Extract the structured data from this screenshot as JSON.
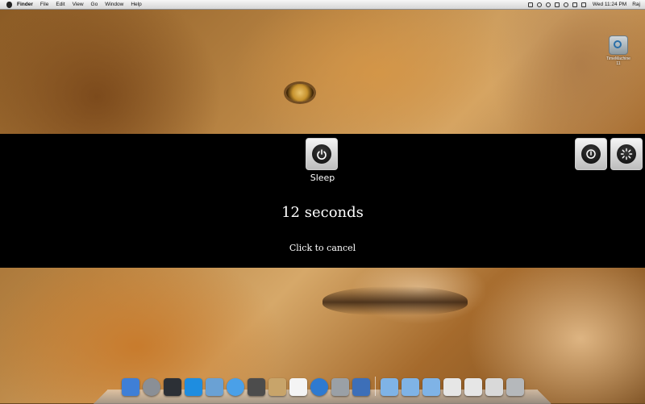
{
  "menubar": {
    "app_name": "Finder",
    "items": [
      "File",
      "Edit",
      "View",
      "Go",
      "Window",
      "Help"
    ],
    "clock": "Wed 11:24 PM",
    "user": "Raj"
  },
  "desktop": {
    "icon_label": "TimeMachine11"
  },
  "overlay": {
    "sleep_label": "Sleep",
    "countdown": "12 seconds",
    "cancel": "Click to cancel"
  },
  "dock": {
    "apps": [
      {
        "name": "finder-icon",
        "color": "#3f7fd6"
      },
      {
        "name": "launchpad-icon",
        "color": "#8a8f96"
      },
      {
        "name": "mission-control-icon",
        "color": "#2c3036"
      },
      {
        "name": "app-store-icon",
        "color": "#1e8de0"
      },
      {
        "name": "preview-icon",
        "color": "#6aa1d4"
      },
      {
        "name": "safari-icon",
        "color": "#4aa0e8"
      },
      {
        "name": "facetime-icon",
        "color": "#4c4c4c"
      },
      {
        "name": "address-book-icon",
        "color": "#c8a46a"
      },
      {
        "name": "ical-icon",
        "color": "#f4f4f4"
      },
      {
        "name": "itunes-icon",
        "color": "#2e7ad0"
      },
      {
        "name": "system-preferences-icon",
        "color": "#9aa0a6"
      },
      {
        "name": "xcode-icon",
        "color": "#3d6fb8"
      },
      {
        "name": "applications-folder-icon",
        "color": "#7fb3e6"
      },
      {
        "name": "documents-folder-icon",
        "color": "#7fb3e6"
      },
      {
        "name": "downloads-folder-icon",
        "color": "#7fb3e6"
      },
      {
        "name": "window-stack-icon",
        "color": "#e6e6e6"
      },
      {
        "name": "window-stack-2-icon",
        "color": "#e6e6e6"
      },
      {
        "name": "window-stack-3-icon",
        "color": "#d9d9d9"
      },
      {
        "name": "trash-icon",
        "color": "#b5b8bb"
      }
    ]
  }
}
